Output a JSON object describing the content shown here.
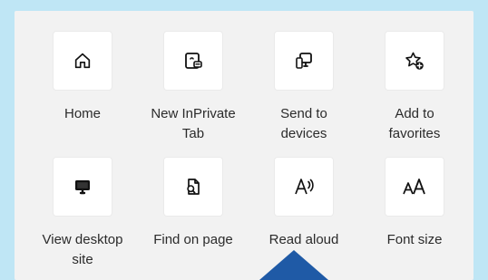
{
  "menu": {
    "items": [
      {
        "label": "Home",
        "icon": "home-icon"
      },
      {
        "label": "New InPrivate\nTab",
        "icon": "inprivate-tab-icon"
      },
      {
        "label": "Send to\ndevices",
        "icon": "send-to-devices-icon"
      },
      {
        "label": "Add to\nfavorites",
        "icon": "add-to-favorites-icon"
      },
      {
        "label": "View desktop\nsite",
        "icon": "desktop-site-icon"
      },
      {
        "label": "Find on page",
        "icon": "find-on-page-icon"
      },
      {
        "label": "Read aloud",
        "icon": "read-aloud-icon"
      },
      {
        "label": "Font size",
        "icon": "font-size-icon"
      }
    ]
  },
  "colors": {
    "background": "#bfe6f5",
    "panel": "#f2f2f2",
    "tile": "#ffffff",
    "text": "#2b2b2b",
    "pointer": "#1f5aa6"
  }
}
